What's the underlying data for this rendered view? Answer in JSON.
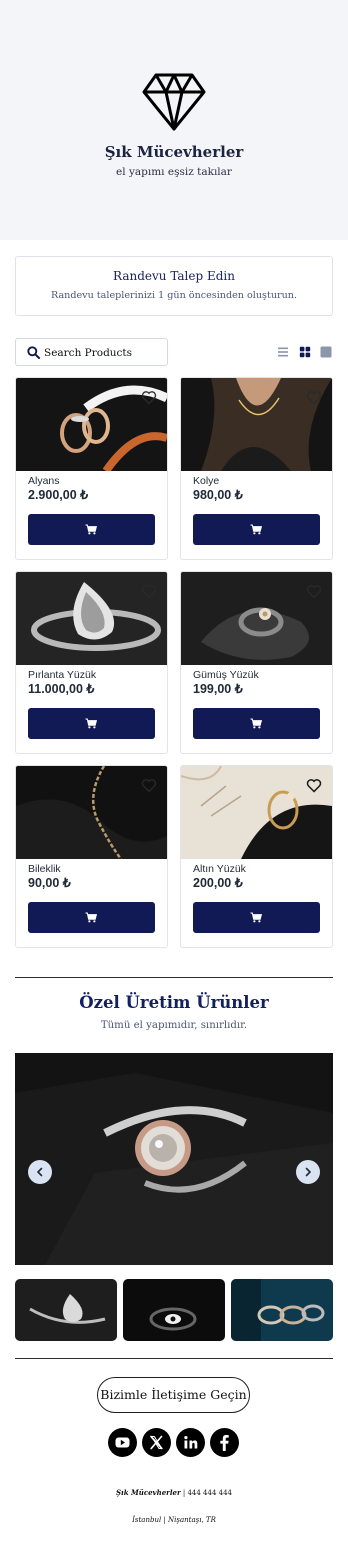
{
  "brand": {
    "name": "Şık Mücevherler",
    "tagline": "el yapımı eşsiz takılar"
  },
  "appointment": {
    "title": "Randevu Talep Edin",
    "subtitle": "Randevu taleplerinizi 1 gün öncesinden oluşturun."
  },
  "search": {
    "placeholder": "Search Products"
  },
  "view_toggle": [
    "list-view-icon",
    "grid-view-icon",
    "single-view-icon"
  ],
  "products": [
    {
      "name": "Alyans",
      "price": "2.900,00 ₺"
    },
    {
      "name": "Kolye",
      "price": "980,00 ₺"
    },
    {
      "name": "Pırlanta Yüzük",
      "price": "11.000,00 ₺"
    },
    {
      "name": "Gümüş Yüzük",
      "price": "199,00 ₺"
    },
    {
      "name": "Bileklik",
      "price": "90,00 ₺"
    },
    {
      "name": "Altın Yüzük",
      "price": "200,00 ₺"
    }
  ],
  "custom": {
    "title": "Özel Üretim Ürünler",
    "subtitle": "Tümü el yapımıdır, sınırlıdır."
  },
  "contact_button": "Bizimle İletişime Geçin",
  "social": [
    "youtube-icon",
    "x-icon",
    "linkedin-icon",
    "facebook-icon"
  ],
  "footer": {
    "brand": "Şık Mücevherler",
    "sep1": "|",
    "phone": "444 444 444",
    "city": "İstanbul",
    "sep2": "|",
    "district": "Nişantaşı, TR"
  },
  "colors": {
    "primary": "#121a56",
    "hero_bg": "#f4f5f9",
    "title_navy": "#13205e"
  }
}
